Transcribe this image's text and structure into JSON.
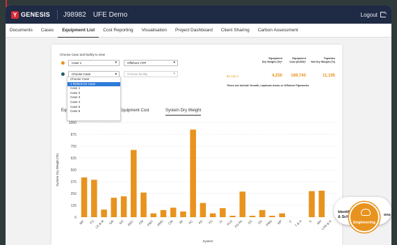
{
  "topbar": {
    "brand": "GENESIS",
    "project_id": "J98982",
    "project_name": "UFE Demo",
    "logout": "Logout"
  },
  "nav": {
    "items": [
      "Documents",
      "Cases",
      "Equipment List",
      "Cost Reporting",
      "Visualisation",
      "Project Dashboard",
      "Client Sharing",
      "Carbon Assessment"
    ],
    "active": "Equipment List"
  },
  "filters": {
    "label": "Choose Case and facility to view",
    "row1_case": "Case 1",
    "row1_facility": "Offshore CPF",
    "row2_case": "Choose Case",
    "row2_facility_placeholder": "Choose facility",
    "dot_colors": [
      "#e8931f",
      "#1f5c6e"
    ]
  },
  "case_dropdown": {
    "options": [
      "1 Reference Case",
      "Case 1",
      "Case 2",
      "Case 3",
      "Case 4",
      "Case 5",
      "Case 6"
    ],
    "highlighted": "1 Reference Case"
  },
  "summary": {
    "head_dry_weight": "Equipment\nDry Weight (Te)*",
    "head_cost": "Equipment\nCost (kUSD)*",
    "head_topsides": "Topsides\nNet Dry Weight (Te)",
    "case_label": "Ex List 1",
    "dry_weight": "4,250",
    "cost": "189,740",
    "topsides": "11,195",
    "note": "*Does not include Growth, Laydown Areas or Offshore Pipeworks"
  },
  "tabs": {
    "items": [
      "Equipment Cost",
      "System Dry Weight"
    ],
    "partial_first": "Equ",
    "active": "System Dry Weight"
  },
  "badge": {
    "left_text_1": "Identif",
    "left_text_2": "& Sch",
    "right_text": "ons",
    "label": "Engineering"
  },
  "chart_data": {
    "type": "bar",
    "color": "#e8931f",
    "xlabel": "System",
    "ylabel": "System Dry Weight (Te)",
    "ylim": [
      0,
      1000
    ],
    "yticks": [
      0,
      125,
      250,
      375,
      500,
      625,
      750,
      875,
      1000
    ],
    "grid": true,
    "categories": [
      "WF",
      "FS",
      "LE & M",
      "GR",
      "GD",
      "GEC",
      "CM",
      "PWT",
      "HMS",
      "CW",
      "WI",
      "PC",
      "PD",
      "FS",
      "CI",
      "FCS",
      "FG PA",
      "DS",
      "DS",
      "PWS",
      "MP",
      "C",
      "T & H",
      "S",
      "MH",
      "LOS & H"
    ],
    "values": [
      420,
      395,
      80,
      205,
      220,
      710,
      260,
      40,
      75,
      100,
      60,
      925,
      150,
      40,
      95,
      15,
      270,
      15,
      75,
      15,
      40,
      0,
      0,
      275,
      280,
      0
    ]
  }
}
